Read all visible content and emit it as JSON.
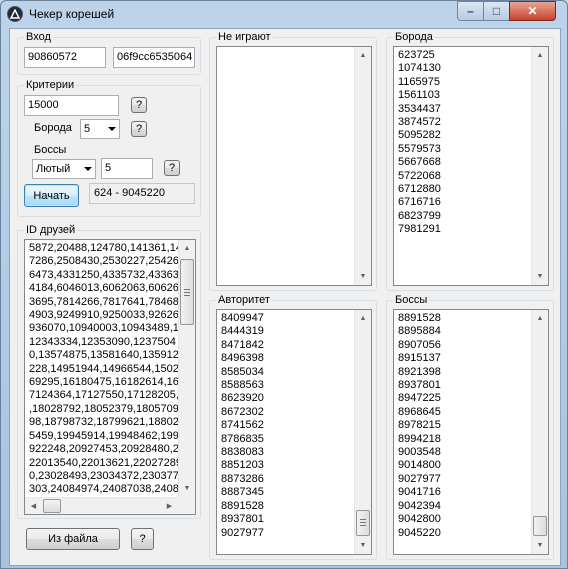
{
  "window": {
    "title": "Чекер корешей",
    "min_glyph": "–",
    "max_glyph": "□",
    "close_glyph": "✕"
  },
  "input_group": {
    "label": "Вход",
    "id_value": "90860572",
    "hash_value": "06f9cc6535064"
  },
  "criteria": {
    "label": "Критерии",
    "threshold_value": "15000",
    "help": "?",
    "beard_label": "Борода",
    "beard_value": "5",
    "bosses_label": "Боссы",
    "boss_type_value": "Лютый",
    "boss_count_value": "5",
    "start_button": "Начать",
    "status": "624 - 9045220"
  },
  "friends": {
    "label": "ID друзей",
    "lines": [
      "5872,20488,124780,141361,14",
      "7286,2508430,2530227,25426",
      "6473,4331250,4335732,43363",
      "4184,6046013,6062063,60626",
      "3695,7814266,7817641,78468",
      "4903,9249910,9250033,92626",
      "936070,10940003,10943489,1",
      "12343334,12353090,1237504",
      "0,13574875,13581640,135912",
      "228,14951944,14966544,1502",
      "69295,16180475,16182614,16",
      "7124364,17127550,17128205,",
      ",18028792,18052379,1805709",
      "98,18798732,18799621,18802",
      "5459,19945914,19948462,199",
      "922248,20927453,20928480,2",
      "22013540,22013621,22027289",
      "0,23028493,23034372,230377",
      "303,24084974,24087038,2408"
    ],
    "from_file_button": "Из файла",
    "help": "?"
  },
  "not_playing": {
    "label": "Не играют",
    "items": []
  },
  "beard": {
    "label": "Борода",
    "items": [
      "623725",
      "1074130",
      "1165975",
      "1561103",
      "3534437",
      "3874572",
      "5095282",
      "5579573",
      "5667668",
      "5722068",
      "6712880",
      "6716716",
      "6823799",
      "7981291"
    ]
  },
  "authority": {
    "label": "Авторитет",
    "items": [
      "8409947",
      "8444319",
      "8471842",
      "8496398",
      "8585034",
      "8588563",
      "8623920",
      "8672302",
      "8741562",
      "8786835",
      "8838083",
      "8851203",
      "8873286",
      "8887345",
      "8891528",
      "8937801",
      "9027977"
    ]
  },
  "bosses": {
    "label": "Боссы",
    "items": [
      "8891528",
      "8895884",
      "8907056",
      "8915137",
      "8921398",
      "8937801",
      "8947225",
      "8968645",
      "8978215",
      "8994218",
      "9003548",
      "9014800",
      "9027977",
      "9041716",
      "9042394",
      "9042800",
      "9045220"
    ]
  },
  "icons": {
    "app": "app-logo-icon",
    "scroll_up": "▲",
    "scroll_down": "▼",
    "scroll_left": "◀",
    "scroll_right": "▶"
  }
}
